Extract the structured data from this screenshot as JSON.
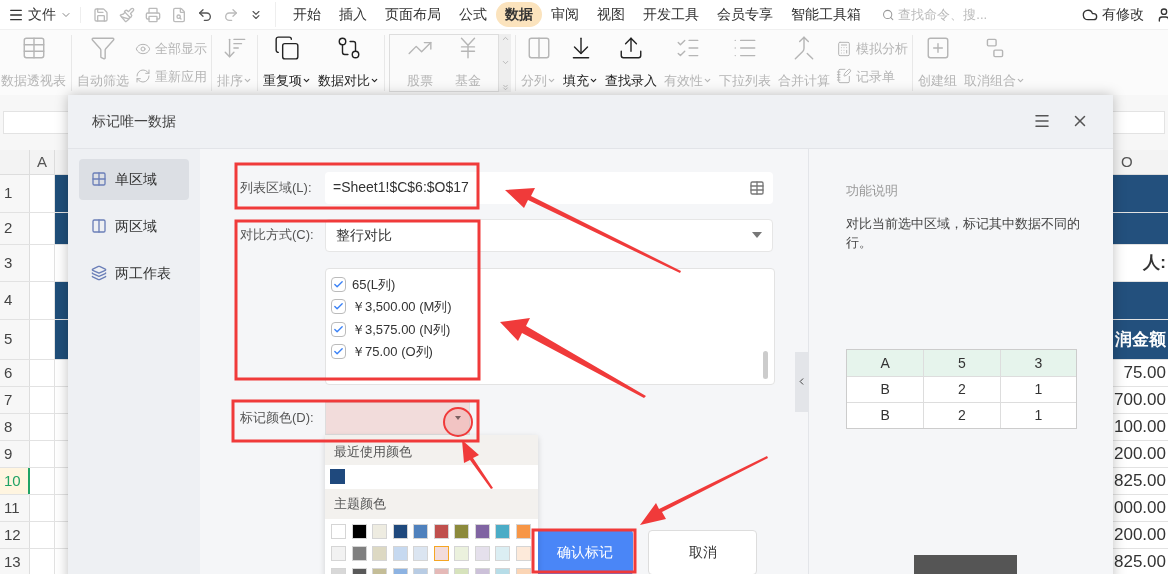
{
  "menu": {
    "file": "文件",
    "tabs": [
      {
        "label": "开始",
        "selected": false
      },
      {
        "label": "插入",
        "selected": false
      },
      {
        "label": "页面布局",
        "selected": false
      },
      {
        "label": "公式",
        "selected": false
      },
      {
        "label": "数据",
        "selected": true
      },
      {
        "label": "审阅",
        "selected": false
      },
      {
        "label": "视图",
        "selected": false
      },
      {
        "label": "开发工具",
        "selected": false
      },
      {
        "label": "会员专享",
        "selected": false
      },
      {
        "label": "智能工具箱",
        "selected": false
      }
    ],
    "search": {
      "placeholder": "查找命令、搜..."
    },
    "status": "有修改"
  },
  "ribbon": {
    "groups": [
      {
        "kind": "plain",
        "items": [
          {
            "kind": "large",
            "label": "数据透视表",
            "disabled": true,
            "dropdown": false
          }
        ]
      },
      {
        "kind": "plain",
        "items": [
          {
            "kind": "large",
            "label": "自动筛选",
            "disabled": true,
            "dropdown": false
          },
          {
            "kind": "stack",
            "items": [
              {
                "label": "全部显示",
                "disabled": true
              },
              {
                "label": "重新应用",
                "disabled": true
              }
            ]
          }
        ]
      },
      {
        "kind": "plain",
        "items": [
          {
            "kind": "large",
            "label": "排序",
            "disabled": true,
            "dropdown": true
          }
        ]
      },
      {
        "kind": "plain",
        "items": [
          {
            "kind": "large",
            "label": "重复项",
            "disabled": false,
            "dropdown": true
          },
          {
            "kind": "large",
            "label": "数据对比",
            "disabled": false,
            "dropdown": true
          }
        ]
      },
      {
        "kind": "gallery",
        "items": [
          {
            "kind": "large",
            "label": "股票",
            "disabled": true,
            "dropdown": false
          },
          {
            "kind": "large",
            "label": "基金",
            "disabled": true,
            "dropdown": false
          }
        ]
      },
      {
        "kind": "plain",
        "items": [
          {
            "kind": "large",
            "label": "分列",
            "disabled": true,
            "dropdown": true
          },
          {
            "kind": "large",
            "label": "填充",
            "disabled": false,
            "dropdown": true
          },
          {
            "kind": "large",
            "label": "查找录入",
            "disabled": false,
            "dropdown": false
          },
          {
            "kind": "large",
            "label": "有效性",
            "disabled": true,
            "dropdown": true
          },
          {
            "kind": "large",
            "label": "下拉列表",
            "disabled": true,
            "dropdown": false
          },
          {
            "kind": "large",
            "label": "合并计算",
            "disabled": true,
            "dropdown": false
          },
          {
            "kind": "stack",
            "items": [
              {
                "label": "模拟分析",
                "disabled": true
              },
              {
                "label": "记录单",
                "disabled": true
              }
            ]
          }
        ]
      },
      {
        "kind": "plain",
        "items": [
          {
            "kind": "large",
            "label": "创建组",
            "disabled": true,
            "dropdown": false
          },
          {
            "kind": "large",
            "label": "取消组合",
            "disabled": true,
            "dropdown": true
          }
        ]
      }
    ]
  },
  "sheet": {
    "column_headers": [
      "A",
      "O"
    ],
    "rows": [
      {
        "number": "1",
        "selected": false,
        "band": true
      },
      {
        "number": "2",
        "selected": false,
        "band": true
      },
      {
        "number": "3",
        "selected": false,
        "band": false,
        "o_cell": "人:"
      },
      {
        "number": "4",
        "selected": false,
        "band": true
      },
      {
        "number": "5",
        "selected": false,
        "band": true,
        "o_cell": "润金额"
      },
      {
        "number": "6",
        "selected": false,
        "band": false,
        "o_cell": "75.00"
      },
      {
        "number": "7",
        "selected": false,
        "band": false,
        "o_cell": "700.00"
      },
      {
        "number": "8",
        "selected": false,
        "band": false,
        "o_cell": "100.00"
      },
      {
        "number": "9",
        "selected": false,
        "band": false,
        "o_cell": "200.00"
      },
      {
        "number": "10",
        "selected": true,
        "band": false,
        "o_cell": "825.00"
      },
      {
        "number": "11",
        "selected": false,
        "band": false,
        "o_cell": "000.00"
      },
      {
        "number": "12",
        "selected": false,
        "band": false,
        "o_cell": "200.00"
      },
      {
        "number": "13",
        "selected": false,
        "band": false,
        "o_cell": "825.00"
      }
    ]
  },
  "dialog": {
    "title": "标记唯一数据",
    "nav": [
      {
        "label": "单区域",
        "selected": true
      },
      {
        "label": "两区域",
        "selected": false
      },
      {
        "label": "两工作表",
        "selected": false
      }
    ],
    "range": {
      "label": "列表区域(L):",
      "value": "=Sheet1!$C$6:$O$17"
    },
    "compare": {
      "label": "对比方式(C):",
      "value": "整行对比"
    },
    "columns": [
      {
        "label": "65(L列)",
        "checked": true
      },
      {
        "label": "￥3,500.00 (M列)",
        "checked": true
      },
      {
        "label": "￥3,575.00 (N列)",
        "checked": true
      },
      {
        "label": "￥75.00 (O列)",
        "checked": true
      }
    ],
    "mark_color": {
      "label": "标记颜色(D):",
      "color": "#f2dcdb"
    },
    "palette": {
      "recent_title": "最近使用颜色",
      "recent": [
        {
          "color": "#1f497d"
        }
      ],
      "theme_title": "主题颜色",
      "theme": [
        {
          "color": "#ffffff",
          "selected": false
        },
        {
          "color": "#000000",
          "selected": false
        },
        {
          "color": "#eeece1",
          "selected": false
        },
        {
          "color": "#1f497d",
          "selected": false
        },
        {
          "color": "#4f81bd",
          "selected": false
        },
        {
          "color": "#c0504d",
          "selected": false
        },
        {
          "color": "#8c8a3c",
          "selected": false
        },
        {
          "color": "#8064a2",
          "selected": false
        },
        {
          "color": "#4bacc6",
          "selected": false
        },
        {
          "color": "#f79646",
          "selected": false
        },
        {
          "color": "#f2f2f2",
          "selected": false
        },
        {
          "color": "#7f7f7f",
          "selected": false
        },
        {
          "color": "#ddd9c3",
          "selected": false
        },
        {
          "color": "#c6d9f0",
          "selected": false
        },
        {
          "color": "#dbe5f1",
          "selected": false
        },
        {
          "color": "#f2dcdb",
          "selected": true
        },
        {
          "color": "#ebf1dd",
          "selected": false
        },
        {
          "color": "#e5e0ec",
          "selected": false
        },
        {
          "color": "#dbeef3",
          "selected": false
        },
        {
          "color": "#fdeada",
          "selected": false
        },
        {
          "color": "#d8d8d8",
          "selected": false
        },
        {
          "color": "#595959",
          "selected": false
        },
        {
          "color": "#c4bd97",
          "selected": false
        },
        {
          "color": "#8db3e2",
          "selected": false
        },
        {
          "color": "#b8cce4",
          "selected": false
        },
        {
          "color": "#e5b9b7",
          "selected": false
        },
        {
          "color": "#d7e3bc",
          "selected": false
        },
        {
          "color": "#ccc1d9",
          "selected": false
        },
        {
          "color": "#b7dde8",
          "selected": false
        },
        {
          "color": "#fbd5b5",
          "selected": false
        }
      ]
    },
    "buttons": {
      "confirm": "确认标记",
      "cancel": "取消"
    },
    "help": {
      "title": "功能说明",
      "text": "对比当前选中区域，标记其中数据不同的行。",
      "table": [
        [
          "A",
          "5",
          "3"
        ],
        [
          "B",
          "2",
          "1"
        ],
        [
          "B",
          "2",
          "1"
        ]
      ]
    }
  }
}
